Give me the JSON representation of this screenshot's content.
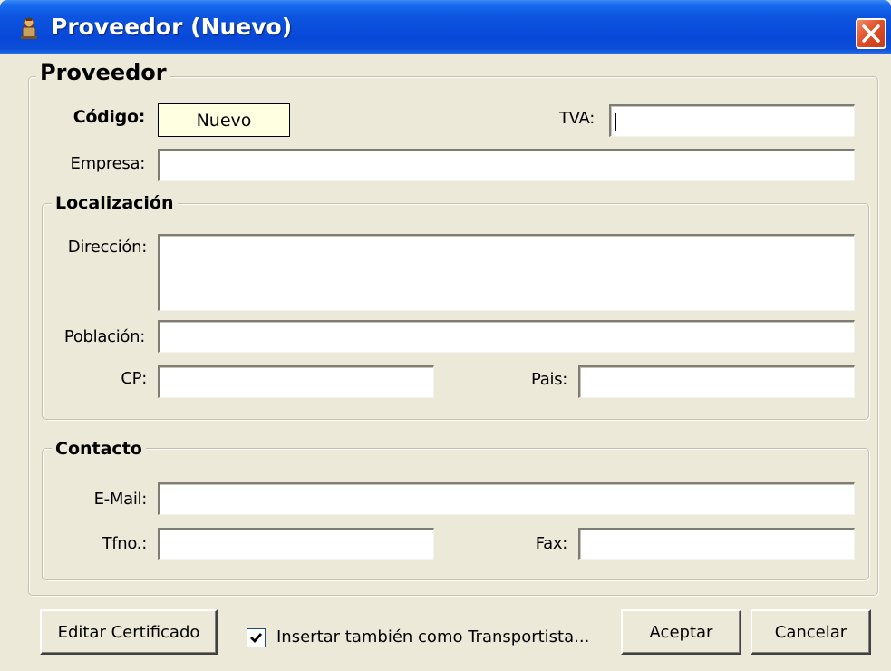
{
  "window": {
    "title": "Proveedor (Nuevo)",
    "icon": "app-person-icon",
    "close_icon": "close-icon"
  },
  "proveedor_group": {
    "title": "Proveedor",
    "codigo_label": "Código:",
    "codigo_value": "Nuevo",
    "tva_label": "TVA:",
    "tva_value": "",
    "empresa_label": "Empresa:",
    "empresa_value": ""
  },
  "localizacion_group": {
    "title": "Localización",
    "direccion_label": "Dirección:",
    "direccion_value": "",
    "poblacion_label": "Población:",
    "poblacion_value": "",
    "cp_label": "CP:",
    "cp_value": "",
    "pais_label": "Pais:",
    "pais_value": ""
  },
  "contacto_group": {
    "title": "Contacto",
    "email_label": "E-Mail:",
    "email_value": "",
    "tfno_label": "Tfno.:",
    "tfno_value": "",
    "fax_label": "Fax:",
    "fax_value": ""
  },
  "footer": {
    "editar_certificado_label": "Editar Certificado",
    "transportista_checkbox_label": "Insertar también como Transportista...",
    "transportista_checked": true,
    "aceptar_label": "Aceptar",
    "cancelar_label": "Cancelar"
  },
  "colors": {
    "dialog_background": "#ECE9D8",
    "titlebar_blue": "#0848D8",
    "codigo_background": "#FFFFE1",
    "close_red": "#E0512A"
  }
}
